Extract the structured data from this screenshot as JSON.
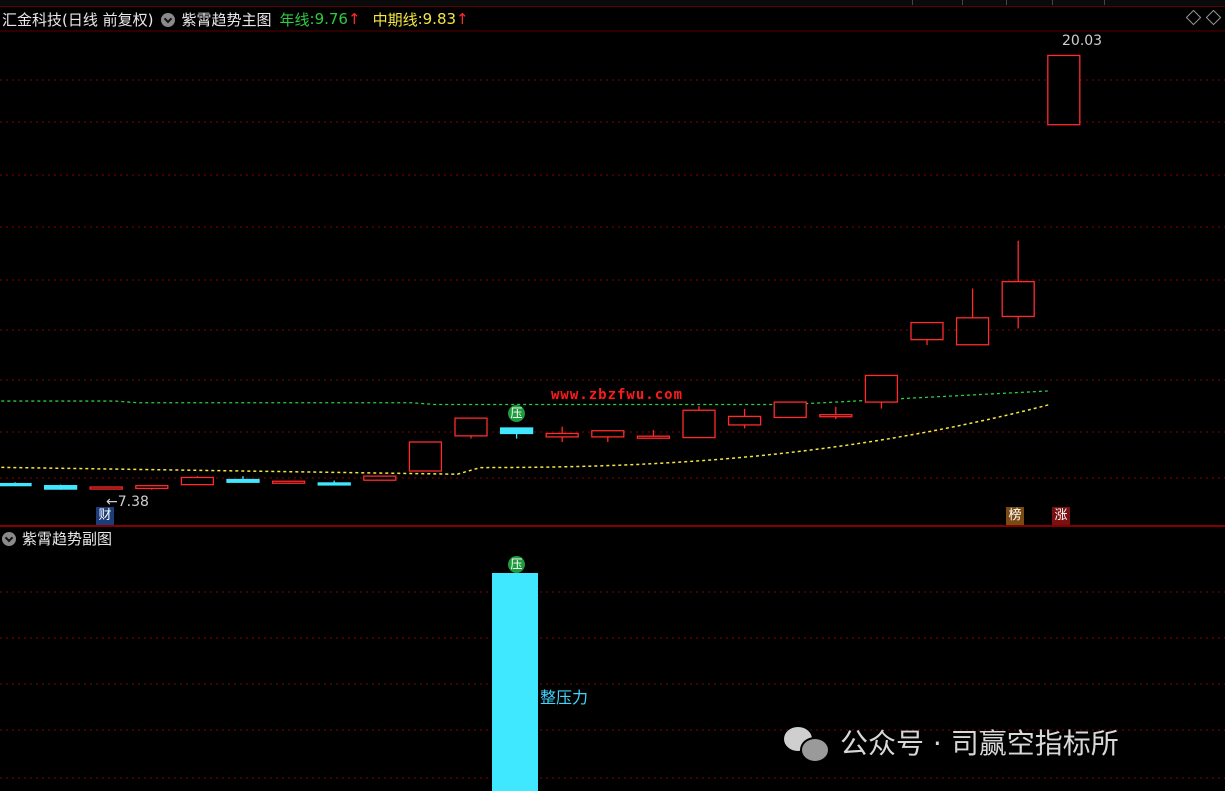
{
  "header": {
    "stock_title": "汇金科技(日线 前复权)",
    "indicator_name": "紫霄趋势主图",
    "year_line_label": "年线",
    "year_line_value": "9.76",
    "mid_line_label": "中期线",
    "mid_line_value": "9.83",
    "up_arrow": "↑"
  },
  "sub_chart": {
    "indicator_name": "紫霄趋势副图",
    "pressure_text": "整压力",
    "ya_marker": "压"
  },
  "price_labels": {
    "high": "20.03",
    "low": "7.38",
    "low_arrow": "←"
  },
  "tags": {
    "cai": "财",
    "bang": "榜",
    "zhang": "涨",
    "ya": "压"
  },
  "watermark": {
    "url": "www.zbzfwu.com",
    "account": "公众号 · 司赢空指标所"
  },
  "colors": {
    "up": "#ff2a2a",
    "down": "#3fe8ff",
    "year_line": "#2ecc40",
    "mid_line": "#f5e642",
    "grid": "#8a0000"
  },
  "chart_data": {
    "type": "candlestick",
    "price_ylim": [
      7.0,
      20.6
    ],
    "candles": [
      {
        "o": 7.48,
        "h": 7.52,
        "c": 7.48,
        "l": 7.43,
        "dir": "down"
      },
      {
        "o": 7.42,
        "h": 7.45,
        "c": 7.32,
        "l": 7.3,
        "dir": "down"
      },
      {
        "o": 7.38,
        "h": 7.4,
        "c": 7.38,
        "l": 7.38,
        "dir": "up"
      },
      {
        "o": 7.34,
        "h": 7.42,
        "c": 7.42,
        "l": 7.3,
        "dir": "up"
      },
      {
        "o": 7.45,
        "h": 7.7,
        "c": 7.66,
        "l": 7.45,
        "dir": "up"
      },
      {
        "o": 7.6,
        "h": 7.7,
        "c": 7.52,
        "l": 7.52,
        "dir": "down"
      },
      {
        "o": 7.5,
        "h": 7.53,
        "c": 7.55,
        "l": 7.47,
        "dir": "up"
      },
      {
        "o": 7.5,
        "h": 7.57,
        "c": 7.5,
        "l": 7.43,
        "dir": "down"
      },
      {
        "o": 7.58,
        "h": 7.7,
        "c": 7.7,
        "l": 7.58,
        "dir": "up"
      },
      {
        "o": 7.85,
        "h": 8.7,
        "c": 8.7,
        "l": 7.85,
        "dir": "up"
      },
      {
        "o": 8.88,
        "h": 9.4,
        "c": 9.4,
        "l": 8.8,
        "dir": "up"
      },
      {
        "o": 9.11,
        "h": 9.05,
        "c": 8.95,
        "l": 8.8,
        "dir": "down"
      },
      {
        "o": 8.85,
        "h": 9.15,
        "c": 8.95,
        "l": 8.7,
        "dir": "up"
      },
      {
        "o": 8.85,
        "h": 8.95,
        "c": 9.03,
        "l": 8.7,
        "dir": "up"
      },
      {
        "o": 8.85,
        "h": 9.05,
        "c": 8.87,
        "l": 8.85,
        "dir": "up"
      },
      {
        "o": 8.83,
        "h": 9.75,
        "c": 9.63,
        "l": 8.83,
        "dir": "up"
      },
      {
        "o": 9.2,
        "h": 9.67,
        "c": 9.45,
        "l": 9.1,
        "dir": "up"
      },
      {
        "o": 9.42,
        "h": 9.83,
        "c": 9.87,
        "l": 9.42,
        "dir": "up"
      },
      {
        "o": 9.5,
        "h": 9.73,
        "c": 9.5,
        "l": 9.37,
        "dir": "up"
      },
      {
        "o": 9.87,
        "h": 10.65,
        "c": 10.65,
        "l": 9.68,
        "dir": "up"
      },
      {
        "o": 11.7,
        "h": 12.2,
        "c": 12.2,
        "l": 11.54,
        "dir": "up"
      },
      {
        "o": 11.55,
        "h": 13.2,
        "c": 12.34,
        "l": 11.55,
        "dir": "up"
      },
      {
        "o": 12.38,
        "h": 14.6,
        "c": 13.4,
        "l": 12.03,
        "dir": "up"
      },
      {
        "o": 18.0,
        "h": 20.03,
        "c": 20.03,
        "l": 18.0,
        "dir": "up"
      }
    ],
    "year_line_label": "年线",
    "mid_line_label": "中期线"
  }
}
